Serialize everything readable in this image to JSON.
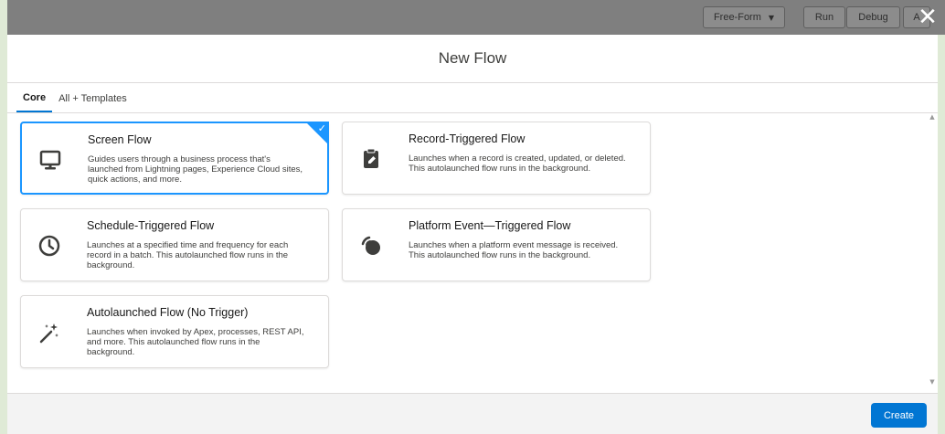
{
  "topbar": {
    "mode_select": "Free-Form",
    "run_label": "Run",
    "debug_label": "Debug",
    "extra_label": "A"
  },
  "modal": {
    "title": "New Flow",
    "tabs": [
      {
        "label": "Core",
        "active": true
      },
      {
        "label": "All + Templates",
        "active": false
      }
    ],
    "cards": [
      {
        "title": "Screen Flow",
        "description": "Guides users through a business process that's launched from Lightning pages, Experience Cloud sites, quick actions, and more.",
        "icon": "monitor-icon",
        "selected": true
      },
      {
        "title": "Record-Triggered Flow",
        "description": "Launches when a record is created, updated, or deleted. This autolaunched flow runs in the background.",
        "icon": "clipboard-edit-icon",
        "selected": false
      },
      {
        "title": "Schedule-Triggered Flow",
        "description": "Launches at a specified time and frequency for each record in a batch. This autolaunched flow runs in the background.",
        "icon": "clock-icon",
        "selected": false
      },
      {
        "title": "Platform Event—Triggered Flow",
        "description": "Launches when a platform event message is received. This autolaunched flow runs in the background.",
        "icon": "signal-icon",
        "selected": false
      },
      {
        "title": "Autolaunched Flow (No Trigger)",
        "description": "Launches when invoked by Apex, processes, REST API, and more. This autolaunched flow runs in the background.",
        "icon": "magic-wand-icon",
        "selected": false
      }
    ],
    "create_label": "Create"
  },
  "colors": {
    "brand": "#0176d3",
    "selected_border": "#1b96ff"
  }
}
